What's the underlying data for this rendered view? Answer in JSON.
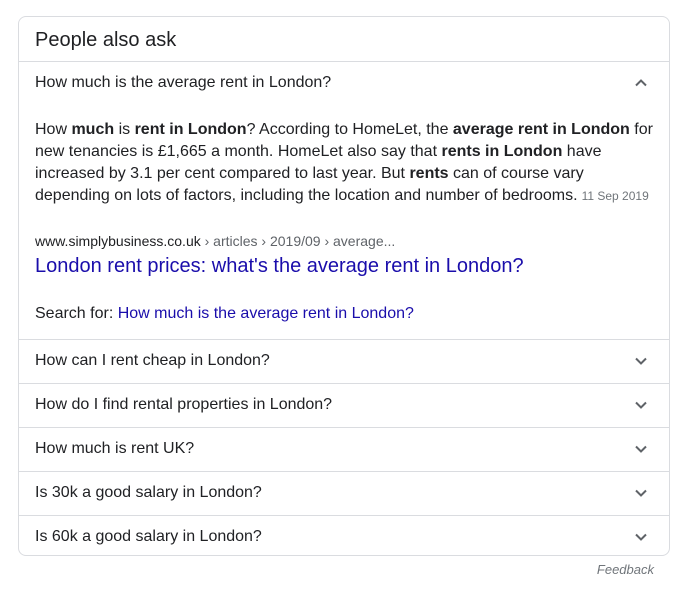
{
  "title": "People also ask",
  "expanded": {
    "question": "How much is the average rent in London?",
    "answer_parts": [
      {
        "t": "How ",
        "b": false
      },
      {
        "t": "much",
        "b": true
      },
      {
        "t": " is ",
        "b": false
      },
      {
        "t": "rent in London",
        "b": true
      },
      {
        "t": "? According to HomeLet, the ",
        "b": false
      },
      {
        "t": "average rent in London",
        "b": true
      },
      {
        "t": " for new tenancies is £1,665 a month. HomeLet also say that ",
        "b": false
      },
      {
        "t": "rents in London",
        "b": true
      },
      {
        "t": " have increased by 3.1 per cent compared to last year. But ",
        "b": false
      },
      {
        "t": "rents",
        "b": true
      },
      {
        "t": " can of course vary depending on lots of factors, including the location and number of bedrooms.",
        "b": false
      }
    ],
    "date": "11 Sep 2019",
    "site": "www.simplybusiness.co.uk",
    "path": " › articles › 2019/09 › average...",
    "link_title": "London rent prices: what's the average rent in London?",
    "search_for_label": "Search for: ",
    "search_for_query": "How much is the average rent in London?"
  },
  "questions": [
    "How can I rent cheap in London?",
    "How do I find rental properties in London?",
    "How much is rent UK?",
    "Is 30k a good salary in London?",
    "Is 60k a good salary in London?"
  ],
  "icons": {
    "expanded": "chevron-up-icon",
    "collapsed": "chevron-down-icon"
  },
  "feedback": "Feedback",
  "colors": {
    "link": "#1a0dab",
    "border": "#dadce0",
    "muted": "#70757a"
  }
}
